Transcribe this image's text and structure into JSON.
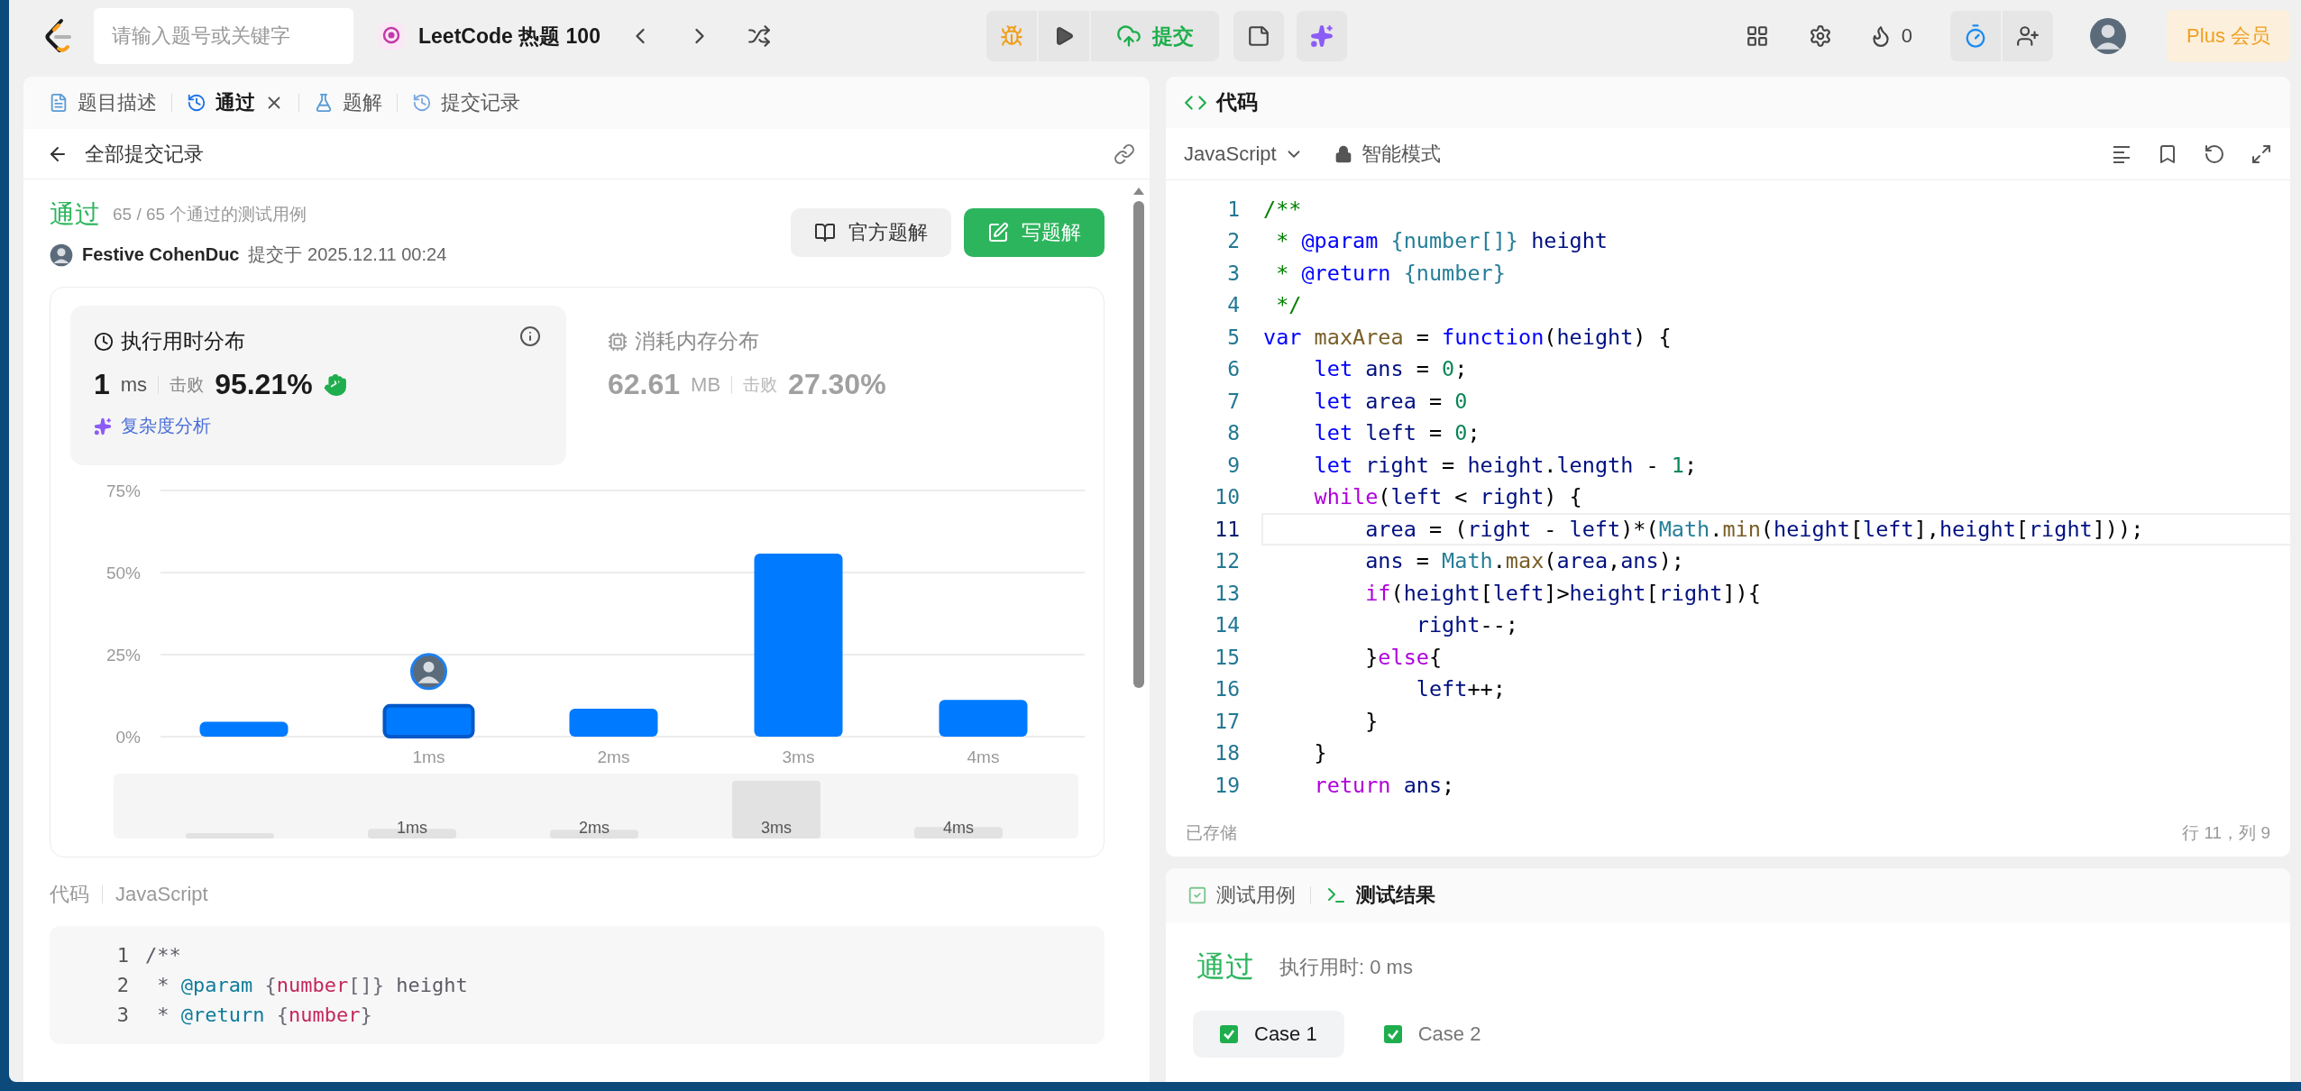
{
  "top_bar": {
    "search": {
      "placeholder": "请输入题号或关键字"
    },
    "problem_list": "LeetCode 热题 100",
    "submit": "提交",
    "streak": "0",
    "plus": "Plus 会员"
  },
  "left_panel": {
    "tabs": [
      {
        "label": "题目描述",
        "selected": false,
        "closable": false
      },
      {
        "label": "通过",
        "selected": true,
        "closable": true
      },
      {
        "label": "题解",
        "selected": false,
        "closable": false
      },
      {
        "label": "提交记录",
        "selected": false,
        "closable": false
      }
    ],
    "back": "全部提交记录",
    "submission": {
      "status": "通过",
      "cases": "65 / 65 个通过的测试用例",
      "author": "Festive CohenDuc",
      "submitted": "提交于 2025.12.11 00:24",
      "buttons": [
        {
          "label": "官方题解",
          "kind": "secondary"
        },
        {
          "label": "写题解",
          "kind": "primary"
        }
      ]
    },
    "stats": [
      {
        "kind": "runtime",
        "title": "执行用时分布",
        "value": "1",
        "unit": "ms",
        "beat_label": "击败",
        "beat": "95.21%",
        "selected": true
      },
      {
        "kind": "memory",
        "title": "消耗内存分布",
        "value": "62.61",
        "unit": "MB",
        "beat_label": "击败",
        "beat": "27.30%",
        "selected": false
      }
    ],
    "analysis_link": "复杂度分析",
    "chart_data": {
      "type": "bar",
      "categories": [
        null,
        "1ms",
        "2ms",
        "3ms",
        "4ms"
      ],
      "series": [
        {
          "color": "#007aff",
          "values": [
            4.5,
            9.4,
            8.5,
            55.8,
            11.2
          ]
        }
      ],
      "ylim": [
        0,
        75
      ],
      "yticks": [
        {
          "value": 0,
          "label": "0%"
        },
        {
          "value": 25,
          "label": "25%"
        },
        {
          "value": 50,
          "label": "50%"
        },
        {
          "value": 75,
          "label": "75%"
        }
      ]
    },
    "bar_states": [
      {
        "selected": false
      },
      {
        "selected": true
      },
      {
        "selected": false
      },
      {
        "selected": false
      },
      {
        "selected": false
      }
    ],
    "overview_labels": [
      "1ms",
      "2ms",
      "3ms",
      "4ms"
    ],
    "code_label": "代码",
    "code_language": "JavaScript",
    "code_lines": [
      {
        "n": "1",
        "tokens": [
          {
            "text": "/**",
            "kind": "comment"
          }
        ]
      },
      {
        "n": "2",
        "tokens": [
          {
            "text": " * ",
            "kind": "comment"
          },
          {
            "text": "@param",
            "kind": "tag"
          },
          {
            "text": " {",
            "kind": "punct"
          },
          {
            "text": "number",
            "kind": "type"
          },
          {
            "text": "[]}",
            "kind": "punct"
          },
          {
            "text": " height",
            "kind": "comment"
          }
        ]
      },
      {
        "n": "3",
        "tokens": [
          {
            "text": " * ",
            "kind": "comment"
          },
          {
            "text": "@return",
            "kind": "tag"
          },
          {
            "text": " {",
            "kind": "punct"
          },
          {
            "text": "number",
            "kind": "type"
          },
          {
            "text": "}",
            "kind": "punct"
          }
        ]
      }
    ]
  },
  "editor": {
    "title": "代码",
    "language": "JavaScript",
    "mode": "智能模式",
    "saved": "已存储",
    "cursor": "行 11，列 9",
    "lines": [
      {
        "n": "1",
        "current": false,
        "tokens": [
          {
            "text": "/**",
            "kind": "comment"
          }
        ]
      },
      {
        "n": "2",
        "current": false,
        "tokens": [
          {
            "text": " * ",
            "kind": "comment"
          },
          {
            "text": "@param",
            "kind": "tag"
          },
          {
            "text": " {number[]}",
            "kind": "type"
          },
          {
            "text": " height",
            "kind": "var"
          }
        ]
      },
      {
        "n": "3",
        "current": false,
        "tokens": [
          {
            "text": " * ",
            "kind": "comment"
          },
          {
            "text": "@return",
            "kind": "tag"
          },
          {
            "text": " {number}",
            "kind": "type"
          }
        ]
      },
      {
        "n": "4",
        "current": false,
        "tokens": [
          {
            "text": " */",
            "kind": "comment"
          }
        ]
      },
      {
        "n": "5",
        "current": false,
        "tokens": [
          {
            "text": "var ",
            "kind": "keyword"
          },
          {
            "text": "maxArea",
            "kind": "fn"
          },
          {
            "text": " = ",
            "kind": "plain"
          },
          {
            "text": "function",
            "kind": "keyword"
          },
          {
            "text": "(",
            "kind": "plain"
          },
          {
            "text": "height",
            "kind": "var"
          },
          {
            "text": ") {",
            "kind": "plain"
          }
        ]
      },
      {
        "n": "6",
        "current": false,
        "tokens": [
          {
            "text": "    let ",
            "kind": "keyword"
          },
          {
            "text": "ans",
            "kind": "var"
          },
          {
            "text": " = ",
            "kind": "plain"
          },
          {
            "text": "0",
            "kind": "number"
          },
          {
            "text": ";",
            "kind": "plain"
          }
        ]
      },
      {
        "n": "7",
        "current": false,
        "tokens": [
          {
            "text": "    let ",
            "kind": "keyword"
          },
          {
            "text": "area",
            "kind": "var"
          },
          {
            "text": " = ",
            "kind": "plain"
          },
          {
            "text": "0",
            "kind": "number"
          }
        ]
      },
      {
        "n": "8",
        "current": false,
        "tokens": [
          {
            "text": "    let ",
            "kind": "keyword"
          },
          {
            "text": "left",
            "kind": "var"
          },
          {
            "text": " = ",
            "kind": "plain"
          },
          {
            "text": "0",
            "kind": "number"
          },
          {
            "text": ";",
            "kind": "plain"
          }
        ]
      },
      {
        "n": "9",
        "current": false,
        "tokens": [
          {
            "text": "    let ",
            "kind": "keyword"
          },
          {
            "text": "right",
            "kind": "var"
          },
          {
            "text": " = ",
            "kind": "plain"
          },
          {
            "text": "height",
            "kind": "var"
          },
          {
            "text": ".",
            "kind": "plain"
          },
          {
            "text": "length",
            "kind": "var"
          },
          {
            "text": " - ",
            "kind": "plain"
          },
          {
            "text": "1",
            "kind": "number"
          },
          {
            "text": ";",
            "kind": "plain"
          }
        ]
      },
      {
        "n": "10",
        "current": false,
        "tokens": [
          {
            "text": "    while",
            "kind": "control"
          },
          {
            "text": "(",
            "kind": "plain"
          },
          {
            "text": "left",
            "kind": "var"
          },
          {
            "text": " < ",
            "kind": "plain"
          },
          {
            "text": "right",
            "kind": "var"
          },
          {
            "text": ") {",
            "kind": "plain"
          }
        ]
      },
      {
        "n": "11",
        "current": true,
        "tokens": [
          {
            "text": "        area",
            "kind": "var"
          },
          {
            "text": " = (",
            "kind": "plain"
          },
          {
            "text": "right",
            "kind": "var"
          },
          {
            "text": " - ",
            "kind": "plain"
          },
          {
            "text": "left",
            "kind": "var"
          },
          {
            "text": ")*(",
            "kind": "plain"
          },
          {
            "text": "Math",
            "kind": "builtin"
          },
          {
            "text": ".",
            "kind": "plain"
          },
          {
            "text": "min",
            "kind": "fn"
          },
          {
            "text": "(",
            "kind": "plain"
          },
          {
            "text": "height",
            "kind": "var"
          },
          {
            "text": "[",
            "kind": "plain"
          },
          {
            "text": "left",
            "kind": "var"
          },
          {
            "text": "],",
            "kind": "plain"
          },
          {
            "text": "height",
            "kind": "var"
          },
          {
            "text": "[",
            "kind": "plain"
          },
          {
            "text": "right",
            "kind": "var"
          },
          {
            "text": "]));",
            "kind": "plain"
          }
        ]
      },
      {
        "n": "12",
        "current": false,
        "tokens": [
          {
            "text": "        ans",
            "kind": "var"
          },
          {
            "text": " = ",
            "kind": "plain"
          },
          {
            "text": "Math",
            "kind": "builtin"
          },
          {
            "text": ".",
            "kind": "plain"
          },
          {
            "text": "max",
            "kind": "fn"
          },
          {
            "text": "(",
            "kind": "plain"
          },
          {
            "text": "area",
            "kind": "var"
          },
          {
            "text": ",",
            "kind": "plain"
          },
          {
            "text": "ans",
            "kind": "var"
          },
          {
            "text": ");",
            "kind": "plain"
          }
        ]
      },
      {
        "n": "13",
        "current": false,
        "tokens": [
          {
            "text": "        if",
            "kind": "control"
          },
          {
            "text": "(",
            "kind": "plain"
          },
          {
            "text": "height",
            "kind": "var"
          },
          {
            "text": "[",
            "kind": "plain"
          },
          {
            "text": "left",
            "kind": "var"
          },
          {
            "text": "]>",
            "kind": "plain"
          },
          {
            "text": "height",
            "kind": "var"
          },
          {
            "text": "[",
            "kind": "plain"
          },
          {
            "text": "right",
            "kind": "var"
          },
          {
            "text": "]){",
            "kind": "plain"
          }
        ]
      },
      {
        "n": "14",
        "current": false,
        "tokens": [
          {
            "text": "            right",
            "kind": "var"
          },
          {
            "text": "--;",
            "kind": "plain"
          }
        ]
      },
      {
        "n": "15",
        "current": false,
        "tokens": [
          {
            "text": "        }",
            "kind": "plain"
          },
          {
            "text": "else",
            "kind": "control"
          },
          {
            "text": "{",
            "kind": "plain"
          }
        ]
      },
      {
        "n": "16",
        "current": false,
        "tokens": [
          {
            "text": "            left",
            "kind": "var"
          },
          {
            "text": "++;",
            "kind": "plain"
          }
        ]
      },
      {
        "n": "17",
        "current": false,
        "tokens": [
          {
            "text": "        }",
            "kind": "plain"
          }
        ]
      },
      {
        "n": "18",
        "current": false,
        "tokens": [
          {
            "text": "    }",
            "kind": "plain"
          }
        ]
      },
      {
        "n": "19",
        "current": false,
        "tokens": [
          {
            "text": "    return ",
            "kind": "control"
          },
          {
            "text": "ans",
            "kind": "var"
          },
          {
            "text": ";",
            "kind": "plain"
          }
        ]
      }
    ]
  },
  "test_panel": {
    "tabs": [
      {
        "label": "测试用例",
        "selected": false
      },
      {
        "label": "测试结果",
        "selected": true
      }
    ],
    "status": "通过",
    "runtime": "执行用时: 0 ms",
    "cases": [
      {
        "label": "Case 1",
        "selected": true
      },
      {
        "label": "Case 2",
        "selected": false
      }
    ]
  }
}
